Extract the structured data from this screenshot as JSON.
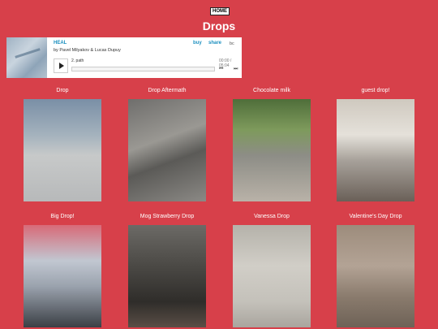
{
  "nav": {
    "home_label": "HOME"
  },
  "page": {
    "title": "Drops"
  },
  "player": {
    "album_title": "HEAL",
    "artist_line": "by Pavel Milyakov & Lucas Dupuy",
    "buy_label": "buy",
    "share_label": "share",
    "logo_text": "bc",
    "track": "2. path",
    "time": "00:00 / 05:04",
    "prev_glyph": "⏮",
    "next_glyph": "⏭"
  },
  "gallery": [
    {
      "caption": "Drop"
    },
    {
      "caption": "Drop Aftermath"
    },
    {
      "caption": "Chocolate milk"
    },
    {
      "caption": "guest drop!"
    },
    {
      "caption": "Big Drop!"
    },
    {
      "caption": "Mog Strawberry Drop"
    },
    {
      "caption": "Vanessa Drop"
    },
    {
      "caption": "Valentine's Day Drop"
    }
  ]
}
